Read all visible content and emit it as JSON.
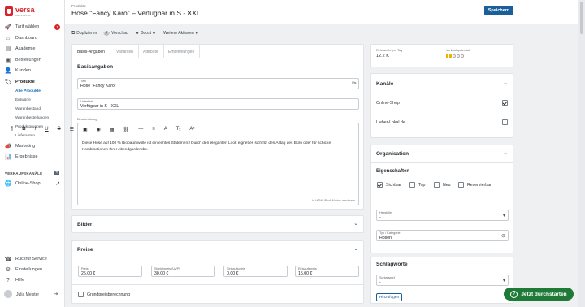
{
  "logo": {
    "brand": "versa",
    "sub": "commerce"
  },
  "sidebar": {
    "items": [
      {
        "label": "Tarif wählen",
        "icon": "rocket-icon",
        "badge": "1"
      },
      {
        "label": "Dashboard",
        "icon": "dashboard-icon"
      },
      {
        "label": "Akademie",
        "icon": "academy-icon"
      },
      {
        "label": "Bestellungen",
        "icon": "inbox-icon"
      },
      {
        "label": "Kunden",
        "icon": "user-icon"
      },
      {
        "label": "Produkte",
        "icon": "tag-icon"
      }
    ],
    "sub_items": [
      "Alle Produkte",
      "Entwürfe",
      "Warenbestand",
      "Warenbestellungen",
      "Produktgruppen",
      "Lieferanten"
    ],
    "items2": [
      {
        "label": "Marketing",
        "icon": "megaphone-icon"
      },
      {
        "label": "Ergebnisse",
        "icon": "chart-icon"
      }
    ],
    "channels_label": "VERKAUFSKANÄLE",
    "channel_item": "Online-Shop",
    "bottom_items": [
      {
        "label": "Rückruf Service",
        "icon": "phone-icon"
      },
      {
        "label": "Einstellungen",
        "icon": "gear-icon"
      },
      {
        "label": "Hilfe",
        "icon": "help-icon"
      }
    ],
    "user_name": "Julia Meister"
  },
  "header": {
    "breadcrumb": "Produkte",
    "title": "Hose \"Fancy Karo\" – Verfügbar in S - XXL",
    "save_label": "Speichern"
  },
  "toolbar": {
    "duplicate": "Duplizieren",
    "preview": "Vorschau",
    "boost": "Boost",
    "more": "Weitere Aktionen"
  },
  "tabs": [
    "Basis-Angaben",
    "Varianten",
    "Attribute",
    "Empfehlungen"
  ],
  "basics": {
    "title": "Basisangaben",
    "title_label": "Titel",
    "title_value": "Hose \"Fancy Karo\"",
    "subtitle_label": "Untertitel",
    "subtitle_value": "Verfügbar in S - XXL",
    "description_label": "Beschreibung",
    "description_text": "Diese Hose auf 100 % Biobaumwolle ist ein echtes Statement! Durch den eleganten Look eignet es sich für den Alltag des Büro oder für schicke Kombinationen Ihrer Abendgarderobe.",
    "editor_hint": "In HTML/Profi-Modus wechseln",
    "editor_tools": [
      "¶",
      "B",
      "I",
      "U",
      "S",
      "☰",
      "▣",
      "◉",
      "▦",
      "⛓",
      "—",
      "≡",
      "A",
      "Tₓ",
      "Aᶻ"
    ]
  },
  "images": {
    "title": "Bilder"
  },
  "prices": {
    "title": "Preise",
    "fields": [
      {
        "label": "Preis",
        "value": "25,00 €"
      },
      {
        "label": "Streichpreis (UVP)",
        "value": "30,00 €"
      },
      {
        "label": "Einkaufspreis",
        "value": "0,00 €"
      },
      {
        "label": "Einkaufspreis",
        "value": "15,00 €"
      }
    ],
    "base_price_label": "Grundpreisberechnung"
  },
  "stats": {
    "reach_label": "Reichweite pro Tag",
    "reach_value": "12.2 K",
    "potential_label": "Verkaufspotential",
    "potential_value": 2,
    "potential_max": 5
  },
  "channels": {
    "title": "Kanäle",
    "items": [
      {
        "label": "Online-Shop",
        "checked": true
      },
      {
        "label": "Lieber-Lokal.de",
        "checked": false
      }
    ]
  },
  "organisation": {
    "title": "Organisation",
    "properties_title": "Eigenschaften",
    "properties": [
      {
        "label": "Sichtbar",
        "checked": true
      },
      {
        "label": "Top",
        "checked": false
      },
      {
        "label": "Neu",
        "checked": false
      },
      {
        "label": "Reservierbar",
        "checked": false
      }
    ],
    "manufacturer_label": "Hersteller",
    "manufacturer_value": "-",
    "category_label": "Typ / Kategorie",
    "category_value": "Hosen"
  },
  "tags": {
    "title": "Schlagworte",
    "field_label": "Schlagwort",
    "field_value": "-",
    "add_label": "Hinzufügen"
  },
  "start_button": "Jetzt durchstarten"
}
